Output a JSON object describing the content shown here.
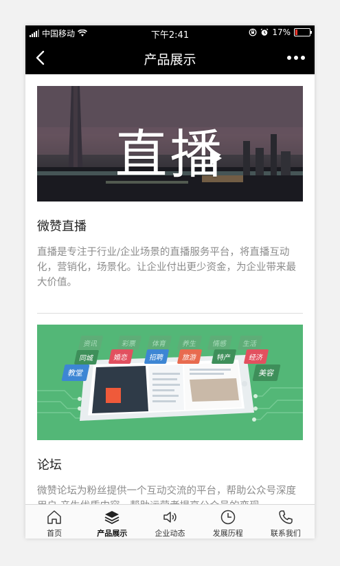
{
  "status_bar": {
    "carrier": "中国移动",
    "time": "下午2:41",
    "battery": "17%",
    "battery_level": 0.17,
    "battery_color": "#ff3b30"
  },
  "nav": {
    "title": "产品展示",
    "back_icon": "chevron-left-icon",
    "more_icon": "more-dots-icon"
  },
  "products": [
    {
      "banner_text": "直播",
      "title": "微赞直播",
      "description": "直播是专注于行业/企业场景的直播服务平台，将直播互动化，营销化，场景化。让企业付出更少资金，为企业带来最大价值。"
    },
    {
      "banner_tags": [
        "同城",
        "婚恋",
        "招聘",
        "旅游",
        "特产",
        "经济",
        "教堂",
        "美容"
      ],
      "banner_tags_faded": [
        "资讯",
        "彩票",
        "体育",
        "养生",
        "情感",
        "生活"
      ],
      "title": "论坛",
      "description": "微赞论坛为粉丝提供一个互动交流的平台，帮助公众号深度用户 产生优质内容，帮助运营者提高公众号的变现"
    }
  ],
  "tabbar": [
    {
      "label": "首页",
      "icon": "home-icon",
      "active": false
    },
    {
      "label": "产品展示",
      "icon": "layers-icon",
      "active": true
    },
    {
      "label": "企业动态",
      "icon": "speaker-icon",
      "active": false
    },
    {
      "label": "发展历程",
      "icon": "clock-icon",
      "active": false
    },
    {
      "label": "联系我们",
      "icon": "phone-icon",
      "active": false
    }
  ],
  "colors": {
    "nav_bg": "#000000",
    "banner2_bg": "#53b777"
  }
}
